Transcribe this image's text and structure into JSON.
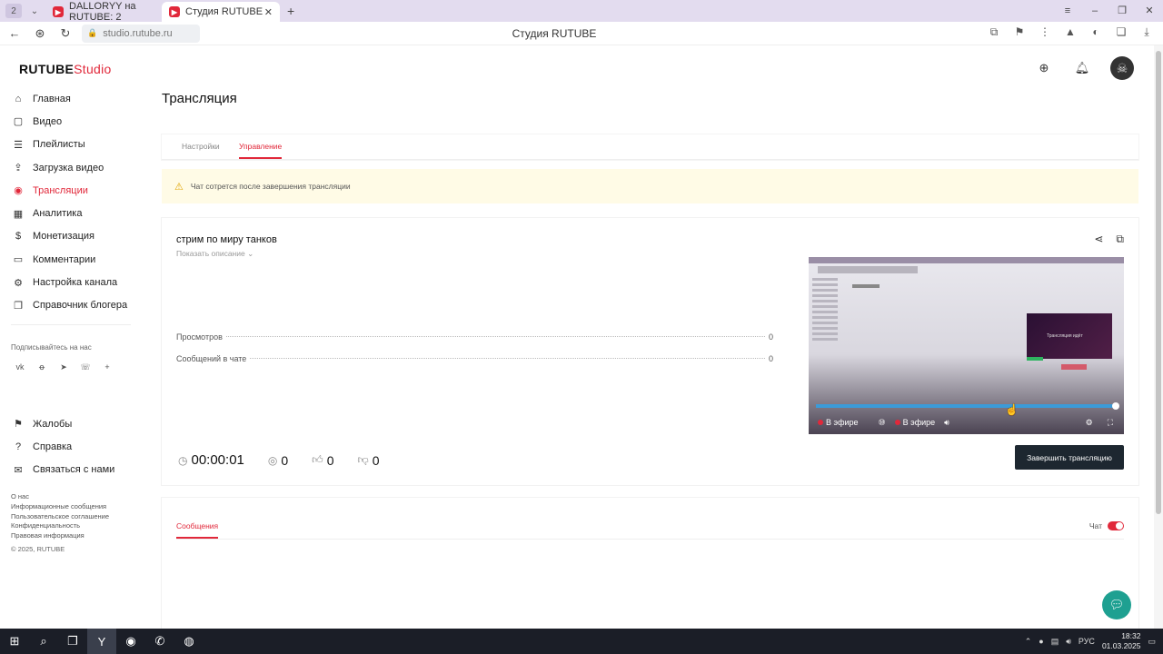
{
  "browser": {
    "workspace_label": "2",
    "tabs": [
      {
        "label": "DALLORYY на RUTUBE: 2"
      },
      {
        "label": "Студия RUTUBE"
      }
    ],
    "url": "studio.rutube.ru",
    "page_title": "Студия RUTUBE"
  },
  "app": {
    "logo_main": "RUTUBE",
    "logo_studio": "Studio"
  },
  "sidebar": {
    "items": [
      {
        "label": "Главная",
        "icon": "home-icon"
      },
      {
        "label": "Видео",
        "icon": "video-icon"
      },
      {
        "label": "Плейлисты",
        "icon": "playlist-icon"
      },
      {
        "label": "Загрузка видео",
        "icon": "upload-icon"
      },
      {
        "label": "Трансляции",
        "icon": "broadcast-icon"
      },
      {
        "label": "Аналитика",
        "icon": "analytics-icon"
      },
      {
        "label": "Монетизация",
        "icon": "money-icon"
      },
      {
        "label": "Комментарии",
        "icon": "comment-icon"
      },
      {
        "label": "Настройка канала",
        "icon": "gear-icon"
      },
      {
        "label": "Справочник блогера",
        "icon": "book-icon"
      }
    ],
    "follow_label": "Подписывайтесь на нас",
    "bottom_items": [
      {
        "label": "Жалобы",
        "icon": "flag-icon"
      },
      {
        "label": "Справка",
        "icon": "help-icon"
      },
      {
        "label": "Связаться с нами",
        "icon": "mail-icon"
      }
    ],
    "footer_links": [
      "О нас",
      "Информационные сообщения",
      "Пользовательское соглашение",
      "Конфиденциальность",
      "Правовая информация"
    ],
    "copyright": "© 2025, RUTUBE"
  },
  "main": {
    "title": "Трансляция",
    "tabs": [
      {
        "label": "Настройки"
      },
      {
        "label": "Управление"
      }
    ],
    "warning": "Чат сотрется после завершения трансляции",
    "stream": {
      "name": "стрим по миру танков",
      "show_description": "Показать описание",
      "stats": [
        {
          "label": "Просмотров",
          "value": "0"
        },
        {
          "label": "Сообщений в чате",
          "value": "0"
        }
      ],
      "timer": "00:00:01",
      "viewers": "0",
      "likes": "0",
      "dislikes": "0",
      "end_button": "Завершить трансляцию",
      "player": {
        "live_label": "В эфире",
        "live_label_2": "В эфире",
        "mini_video_text": "Трансляция идёт"
      }
    },
    "chat": {
      "messages_tab": "Сообщения",
      "chat_label": "Чат",
      "chat_enabled": true
    }
  },
  "taskbar": {
    "lang": "РУС",
    "time": "18:32",
    "date": "01.03.2025"
  },
  "colors": {
    "accent": "#e1283a",
    "end_button": "#1d2730",
    "warning_bg": "#fffbe6",
    "support": "#1ea091"
  }
}
